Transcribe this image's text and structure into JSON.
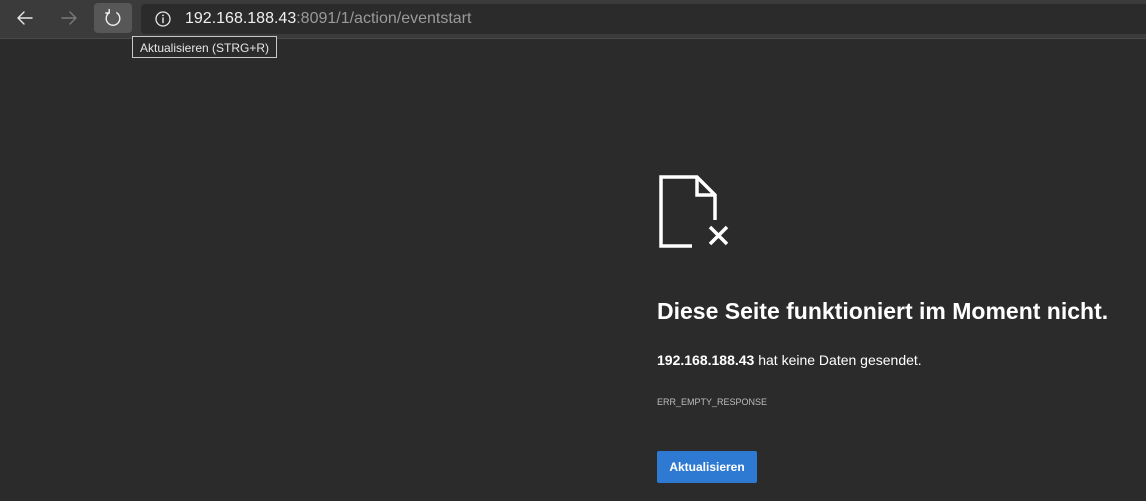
{
  "browser": {
    "url_host": "192.168.188.43",
    "url_rest": ":8091/1/action/eventstart",
    "tooltip": "Aktualisieren (STRG+R)",
    "icons": {
      "back": "arrow-left-icon",
      "forward": "arrow-right-icon",
      "reload": "reload-icon",
      "site_info": "info-circle-icon"
    }
  },
  "error_page": {
    "icon": "broken-page-icon",
    "title": "Diese Seite funktioniert im Moment nicht.",
    "host": "192.168.188.43",
    "message": " hat keine Daten gesendet.",
    "code": "ERR_EMPTY_RESPONSE",
    "button_label": "Aktualisieren"
  },
  "colors": {
    "background": "#2b2b2b",
    "toolbar": "#3b3b3b",
    "button_blue": "#2e7ad2"
  }
}
